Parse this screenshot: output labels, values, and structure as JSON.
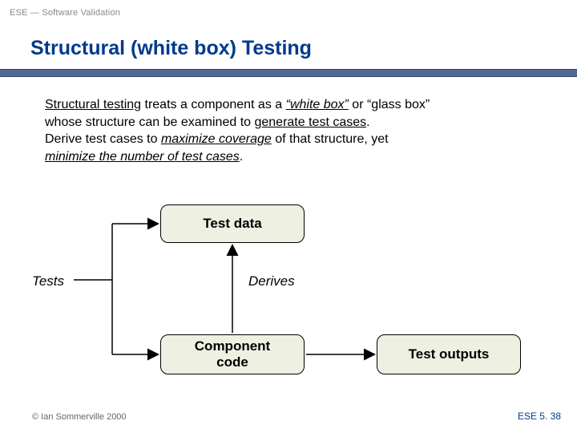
{
  "header": {
    "breadcrumb": "ESE — Software Validation"
  },
  "title": "Structural (white box) Testing",
  "body": {
    "p1_a": "Structural testing",
    "p1_b": " treats a component as a ",
    "p1_c": "“white box”",
    "p1_d": " or “glass box”",
    "p2_a": "whose structure can be examined to ",
    "p2_b": "generate test cases",
    "p2_c": ".",
    "p3_a": "Derive test cases to ",
    "p3_b": "maximize coverage",
    "p3_c": " of that structure, yet",
    "p4_a": "minimize the number of test cases",
    "p4_b": "."
  },
  "diagram": {
    "nodes": {
      "test_data": "Test data",
      "tests": "Tests",
      "derives": "Derives",
      "component_code": "Component\ncode",
      "test_outputs": "Test outputs"
    },
    "edges": [
      {
        "from": "component_code",
        "to": "test_data",
        "label": "Derives"
      },
      {
        "from": "tests_entry",
        "to": "test_data"
      },
      {
        "from": "tests_entry",
        "to": "component_code"
      },
      {
        "from": "component_code",
        "to": "test_outputs"
      }
    ],
    "colors": {
      "box_fill": "#eef0e2",
      "box_border": "#000000",
      "arrow": "#000000"
    }
  },
  "footer": {
    "left": "© Ian Sommerville 2000",
    "right": "ESE 5. 38"
  },
  "chart_data": {
    "type": "diagram",
    "title": "Structural (white box) Testing",
    "nodes": [
      {
        "id": "test_data",
        "label": "Test data"
      },
      {
        "id": "component_code",
        "label": "Component code"
      },
      {
        "id": "test_outputs",
        "label": "Test outputs"
      },
      {
        "id": "tests",
        "label": "Tests",
        "kind": "label"
      }
    ],
    "edges": [
      {
        "from": "component_code",
        "to": "test_data",
        "label": "Derives"
      },
      {
        "from": "tests",
        "to": "test_data"
      },
      {
        "from": "tests",
        "to": "component_code"
      },
      {
        "from": "component_code",
        "to": "test_outputs"
      }
    ]
  }
}
